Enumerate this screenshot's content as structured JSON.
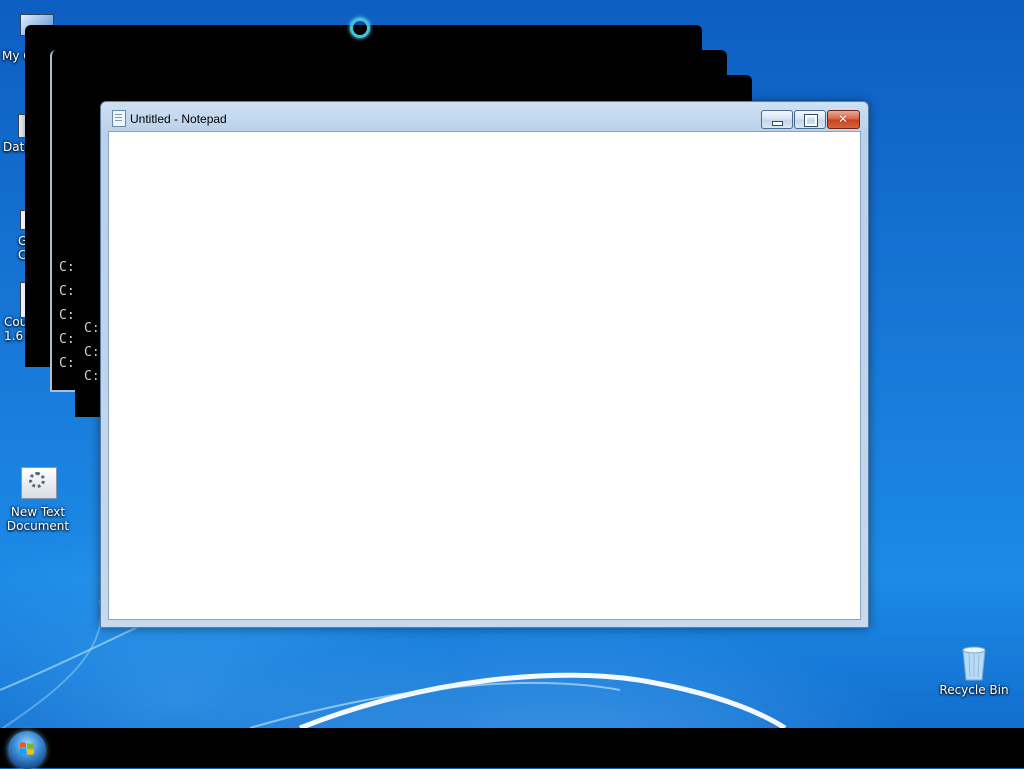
{
  "desktop": {
    "icons": [
      {
        "label": "My C",
        "icon": "computer-icon"
      },
      {
        "label": "Data",
        "icon": "database-icon"
      },
      {
        "label": "G\nC",
        "icon": "app-icon"
      },
      {
        "label": "Cou\n1.6",
        "icon": "app-icon"
      },
      {
        "label": "New Text\nDocument",
        "icon": "settings-document-icon"
      },
      {
        "label": "Recycle Bin",
        "icon": "recycle-bin-icon"
      }
    ]
  },
  "console_windows": {
    "lines_a": [
      "C:",
      "C:",
      "C:",
      "C:",
      "C:"
    ],
    "lines_b": [
      "C:",
      "C:",
      "C:"
    ]
  },
  "notepad": {
    "title": "Untitled - Notepad",
    "content": "",
    "buttons": {
      "minimize": "minimize",
      "maximize": "maximize",
      "close": "close"
    }
  },
  "taskbar": {
    "start_icon": "windows-start-orb"
  },
  "colors": {
    "desktop_blue": "#1778d8",
    "taskbar": "#000000",
    "close_red": "#c7401c",
    "spinner": "#3fc5e0"
  }
}
